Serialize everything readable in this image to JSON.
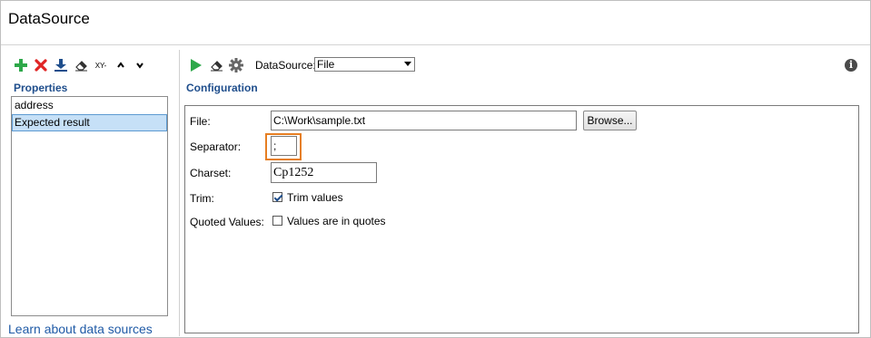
{
  "window": {
    "title": "DataSource"
  },
  "left_toolbar": {
    "add": "add-icon",
    "delete": "delete-icon",
    "import": "download-icon",
    "clear": "eraser-icon",
    "xy_label": "XY-",
    "move_up": "chevron-up-icon",
    "move_down": "chevron-down-icon"
  },
  "properties": {
    "heading": "Properties",
    "items": [
      {
        "label": "address",
        "selected": false
      },
      {
        "label": "Expected result",
        "selected": true
      }
    ]
  },
  "help_link": "Learn about data sources",
  "right_toolbar": {
    "run": "play-icon",
    "clear": "eraser-icon",
    "settings": "gear-icon",
    "datasource_label": "DataSource:",
    "datasource_value": "File",
    "info": "i"
  },
  "configuration": {
    "heading": "Configuration",
    "file_label": "File:",
    "file_value": "C:\\Work\\sample.txt",
    "browse_label": "Browse...",
    "separator_label": "Separator:",
    "separator_value": ";",
    "charset_label": "Charset:",
    "charset_value": "Cp1252",
    "trim_label": "Trim:",
    "trim_checkbox_label": "Trim values",
    "trim_checked": true,
    "quoted_label": "Quoted Values:",
    "quoted_checkbox_label": "Values are in quotes",
    "quoted_checked": false
  },
  "colors": {
    "accent_heading": "#1f4e8c",
    "selection": "#c6e0f7",
    "highlight": "#e67e22",
    "add_green": "#2ea84a",
    "delete_red": "#e02424",
    "run_green": "#2ea84a"
  }
}
